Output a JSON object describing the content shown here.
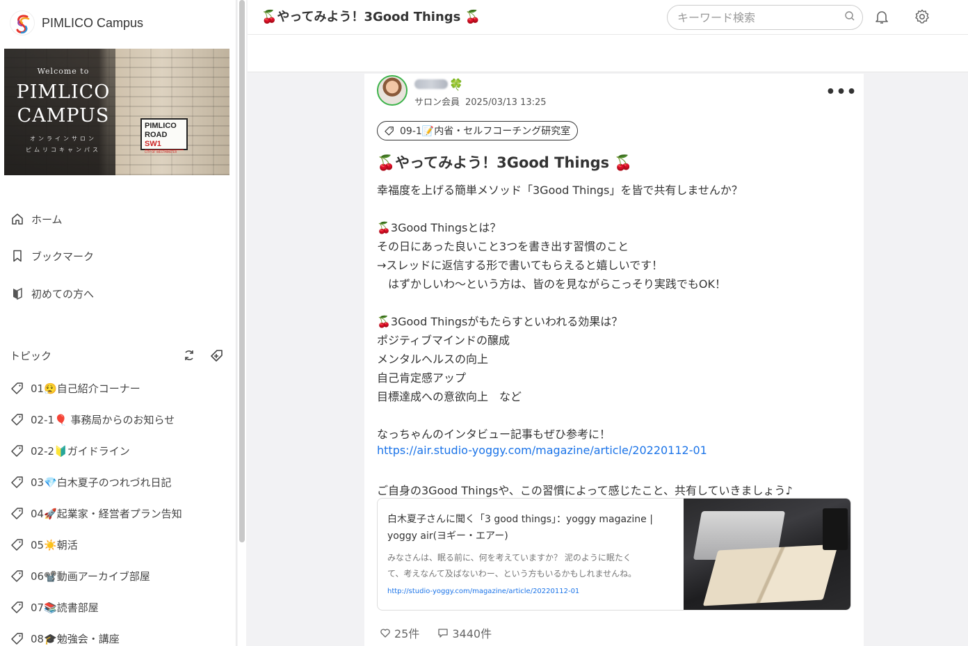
{
  "app": {
    "name": "PIMLICO Campus"
  },
  "banner": {
    "welcome": "Welcome to",
    "line1": "PIMLICO",
    "line2": "CAMPUS",
    "sub1": "オンラインサロン",
    "sub2": "ピムリコキャンパス",
    "sign_line1": "PIMLICO",
    "sign_line2a": "ROAD ",
    "sign_line2b": "SW1",
    "sign_line3": "CITY OF WESTMINSTER"
  },
  "nav": {
    "items": [
      {
        "label": "ホーム",
        "icon": "home-icon"
      },
      {
        "label": "ブックマーク",
        "icon": "bookmark-icon"
      },
      {
        "label": "初めての方へ",
        "icon": "beginner-icon"
      }
    ]
  },
  "topics": {
    "header": "トピック",
    "items": [
      {
        "label": "01😮‍💨自己紹介コーナー"
      },
      {
        "label": "02-1🎈 事務局からのお知らせ"
      },
      {
        "label": "02-2🔰ガイドライン"
      },
      {
        "label": "03💎白木夏子のつれづれ日記"
      },
      {
        "label": "04🚀起業家・経営者プラン告知"
      },
      {
        "label": "05☀️朝活"
      },
      {
        "label": "06📽️動画アーカイブ部屋"
      },
      {
        "label": "07📚読書部屋"
      },
      {
        "label": "08🎓勉強会・講座"
      }
    ]
  },
  "header": {
    "title": "🍒やってみよう！3Good Things 🍒",
    "search_placeholder": "キーワード検索"
  },
  "post": {
    "author_suffix": "🍀",
    "role": "サロン会員",
    "date": "2025/03/13 13:25",
    "more": "•••",
    "tag": "09-1📝内省・セルフコーチング研究室",
    "title": "🍒やってみよう！3Good Things 🍒",
    "body": [
      "幸福度を上げる簡単メソッド「3Good Things」を皆で共有しませんか？",
      "🍒3Good Thingsとは？",
      "その日にあった良いこと3つを書き出す習慣のこと",
      "→スレッドに返信する形で書いてもらえると嬉しいです！",
      "　はずかしいわ〜という方は、皆のを見ながらこっそり実践でもOK！",
      "🍒3Good Thingsがもたらすといわれる効果は？",
      "ポジティブマインドの醸成",
      "メンタルヘルスの向上",
      "自己肯定感アップ",
      "目標達成への意欲向上　など",
      "なっちゃんのインタビュー記事もぜひ参考に！",
      "ご自身の3Good Thingsや、この習慣によって感じたこと、共有していきましょう♪"
    ],
    "link": "https://air.studio-yoggy.com/magazine/article/20220112-01",
    "ogp": {
      "title_l1": "白木夏子さんに聞く「3 good things」：yoggy magazine |",
      "title_l2": "yoggy air(ヨギー・エアー)",
      "desc_l1": "みなさんは、眠る前に、何を考えていますか？ 泥のように眠たく",
      "desc_l2": "て、考えなんて及ばないわー、という方もいるかもしれませんね。",
      "url": "http://studio-yoggy.com/magazine/article/20220112-01"
    },
    "likes": "25件",
    "comments": "3440件"
  },
  "colors": {
    "accent_link": "#1a73e8",
    "avatar_ring": "#3cb34a"
  }
}
